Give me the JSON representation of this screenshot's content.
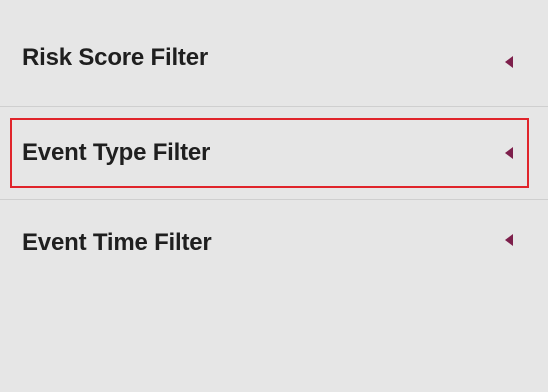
{
  "filters": {
    "items": [
      {
        "label": "Risk Score Filter",
        "state": "collapsed"
      },
      {
        "label": "Event Type Filter",
        "state": "collapsed",
        "highlighted": true
      },
      {
        "label": "Event Time Filter",
        "state": "collapsed"
      }
    ]
  },
  "icons": {
    "caret": "caret-left-icon"
  },
  "colors": {
    "background": "#e6e6e6",
    "text": "#1f1f1f",
    "caret": "#7d1f4b",
    "highlight": "#e0242b",
    "divider": "#cfcfcf"
  }
}
